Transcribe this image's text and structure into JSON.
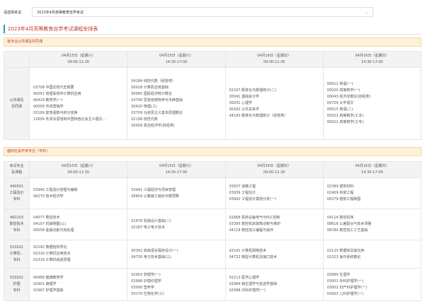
{
  "selector": {
    "label": "请选择考试",
    "value": "2023年4月高等教育自学考试"
  },
  "page_title": "2023年4月高等教育自学考试课程安排表",
  "section1": {
    "title": "各专业公共课及共同课",
    "headers": [
      {
        "date": "04月15日（星期六）",
        "time": "09:00-11:30"
      },
      {
        "date": "04月15日（星期六）",
        "time": "14:30-17:00"
      },
      {
        "date": "04月16日（星期日）",
        "time": "09:00-11:30"
      },
      {
        "date": "04月16日（星期日）",
        "time": "14:30-17:00"
      }
    ],
    "row": {
      "label": [
        "公共课及",
        "共同课"
      ],
      "cells": [
        [
          "03708 中国近现代史纲要",
          "00051 管理系统中计算机应用",
          "00429 教育学(一)",
          "00058 市场营销学",
          "02199 复变函数与积分变换",
          "12656 毛泽东思想和中国特色社会主义理论..."
        ],
        [
          "04184 线性代数（经管类）",
          "00018 计算机应用基础",
          "00065 国民经济统计概论",
          "03706 思想道德修养与法律基础",
          "00420 物理(工)",
          "03709 马克思主义基本原理概论",
          "02198 线性代数",
          "00009 政治经济学(财经类)"
        ],
        [
          "02197 概率论与数理统计(二)",
          "00041 基础会计学",
          "00031 心理学",
          "00182 公共关系学",
          "04183 概率论与数理统计（经管类）"
        ],
        [
          "00012 英语(一)",
          "00020 高等数学(一)",
          "00043 经济法概论(财经类)",
          "04729 大学语文",
          "00015 英语(二)",
          "00023 高等数学(工本)",
          "00022 高等数学(工专)"
        ]
      ]
    }
  },
  "section2": {
    "title": "面向社会开考专业（专科）",
    "header_label": [
      "考试专业",
      "及课程"
    ],
    "headers": [
      {
        "date": "04月15日（星期六）",
        "time": "09:00-11:30"
      },
      {
        "date": "04月15日（星期六）",
        "time": "14:30-17:00"
      },
      {
        "date": "04月16日（星期日）",
        "time": "09:00-11:30"
      },
      {
        "date": "04月16日（星期日）",
        "time": "14:30-17:00"
      }
    ],
    "rows": [
      {
        "label": [
          "440501",
          "工程造价",
          "专科"
        ],
        "cells": [
          [
            "03940 工程造价管理与编制",
            "06270 技术经济学"
          ],
          [
            "03941 工程经济与项目管理",
            "06804 公路施工组织与概预算"
          ],
          [
            "03937 道路工程",
            "03939 工程估计",
            "03942 工程造价案例分析(一)"
          ],
          [
            "02389 建筑材料",
            "02409 桥梁工程",
            "06279 建筑工程制图"
          ]
        ]
      },
      {
        "label": [
          "460103",
          "数控技术",
          "专科"
        ],
        "cells": [
          [
            "04077 数控技术",
            "04107 机械制图(三)",
            "06558 金属切削与热处理"
          ],
          [
            "01978 机械设计基础(二)",
            "02187 电工电子技术"
          ],
          [
            "01668 机床设备电气与PLC控制",
            "03395 数控机床故障诊断与维护",
            "04118 数控加工编程与操作"
          ],
          [
            "04114 数控机床",
            "08616 公差配合与技术测量",
            "08784 数控加工工艺基础"
          ]
        ]
      },
      {
        "label": [
          "510201",
          "计算机...",
          "专科"
        ],
        "cells": [
          [
            "02142 数据结构导论",
            "02316 计算机应用技术",
            "02318 计算机组成原理"
          ],
          [
            "00342 高级语言程序设计(一)",
            "04730 电子技术基础(三)"
          ],
          [
            "02141 计算机网络技术",
            "04732 微型计算机及接口技术"
          ],
          [
            "02120 数据库及其应用",
            "02323 操作系统概论"
          ]
        ]
      },
      {
        "label": [
          "520201",
          "护理",
          "专科"
        ],
        "cells": [
          [
            "00488 健康教育学",
            "02901 病理学",
            "02997 护理学基础"
          ],
          [
            "02903 药理学(一)",
            "02996 护理伦理学",
            "03000 营养学",
            "03179 生物化学(三)"
          ],
          [
            "02113 医学心理学",
            "02964 病生理学与急症学基础",
            "02998 内科护理学(一)"
          ],
          [
            "02899 生理学",
            "03001 外科护理学(一)",
            "03002 妇产科护理学(一)",
            "03003 儿科护理学(一)"
          ]
        ]
      }
    ]
  }
}
